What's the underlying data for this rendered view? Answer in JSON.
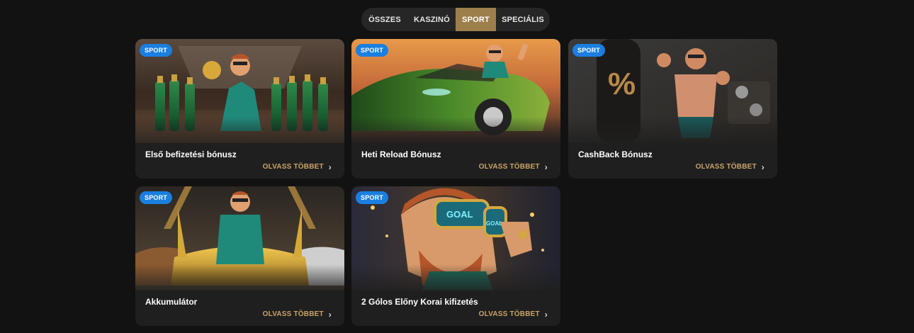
{
  "filter_tabs": [
    {
      "label": "ÖSSZES",
      "active": false
    },
    {
      "label": "KASZINÓ",
      "active": false
    },
    {
      "label": "SPORT",
      "active": true
    },
    {
      "label": "SPECIÁLIS",
      "active": false
    }
  ],
  "cards": [
    {
      "badge": "SPORT",
      "title": "Első befizetési bónusz",
      "cta": "OLVASS TÖBBET",
      "image": "bowling-with-champagne-bottles"
    },
    {
      "badge": "SPORT",
      "title": "Heti Reload Bónusz",
      "cta": "OLVASS TÖBBET",
      "image": "green-sports-car-waving"
    },
    {
      "badge": "SPORT",
      "title": "CashBack Bónusz",
      "cta": "OLVASS TÖBBET",
      "image": "boxer-with-percent-punching-bag"
    },
    {
      "badge": "SPORT",
      "title": "Akkumulátor",
      "cta": "OLVASS TÖBBET",
      "image": "man-on-golden-sports-car"
    },
    {
      "badge": "SPORT",
      "title": "2 Gólos Előny Korai kifizetés",
      "cta": "OLVASS TÖBBET",
      "image": "man-with-goal-sunglasses"
    }
  ],
  "image_text": {
    "percent_sign": "%",
    "goal_lens_left": "GOAL",
    "goal_lens_right": "GOAL"
  },
  "colors": {
    "background": "#121212",
    "active_tab": "#9d7f4c",
    "badge": "#1a7fe0",
    "cta": "#c9a46a"
  }
}
